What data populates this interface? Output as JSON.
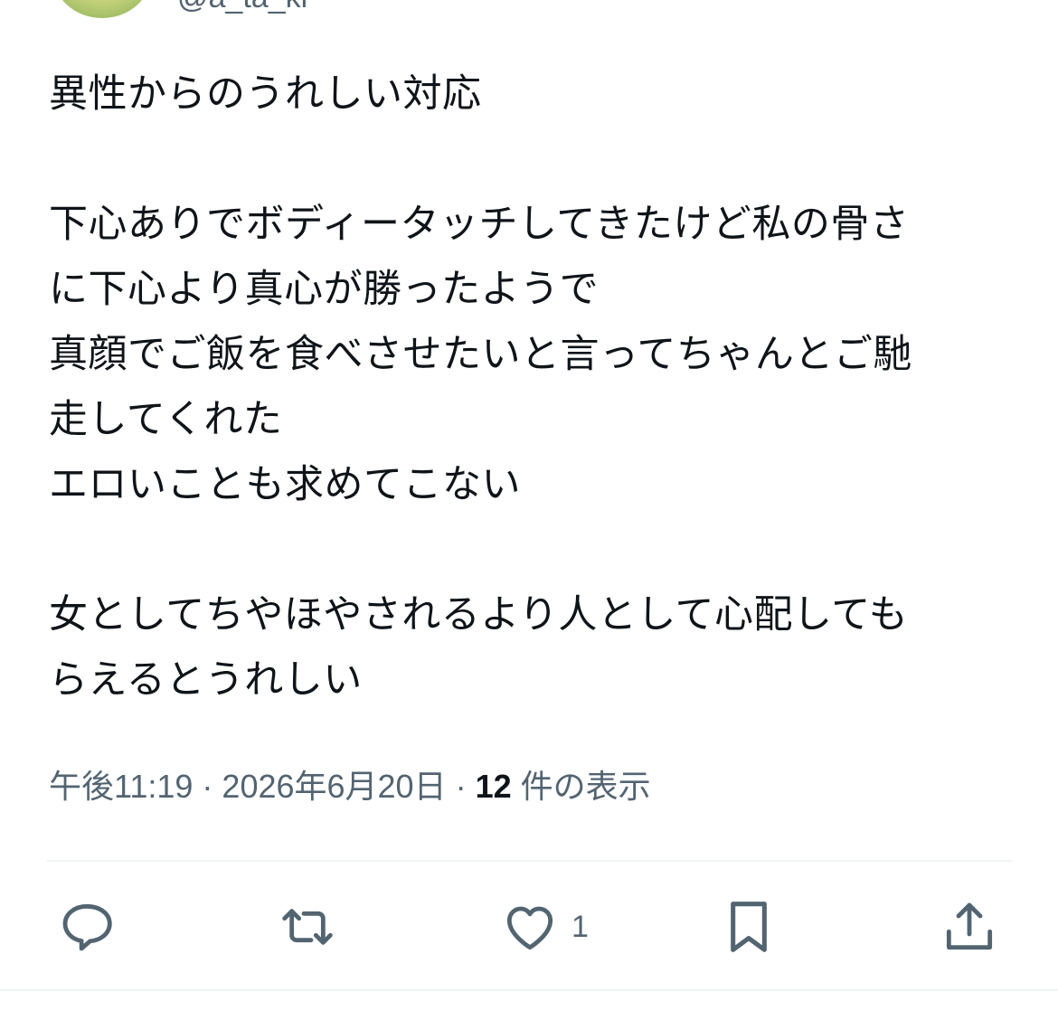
{
  "author": {
    "handle": "@a_ta_ki"
  },
  "tweet": {
    "paragraphs": [
      "異性からのうれしい対応",
      "",
      "下心ありでボディータッチしてきたけど私の骨さ\nに下心より真心が勝ったようで\n真顔でご飯を食べさせたいと言ってちゃんとご馳\n走してくれた\nエロいことも求めてこない",
      "",
      "女としてちやほやされるより人として心配しても\nらえるとうれしい"
    ]
  },
  "meta": {
    "time": "午後11:19",
    "separator": "·",
    "date": "2026年6月20日",
    "view_count": "12",
    "view_label": "件の表示"
  },
  "actions": {
    "reply_icon": "speech-bubble-icon",
    "retweet_icon": "retweet-arrows-icon",
    "like_icon": "heart-icon",
    "like_count": "1",
    "bookmark_icon": "bookmark-icon",
    "share_icon": "upload-share-icon"
  },
  "colors": {
    "text_primary": "#0f1419",
    "text_secondary": "#536471",
    "divider": "#eff3f4"
  }
}
